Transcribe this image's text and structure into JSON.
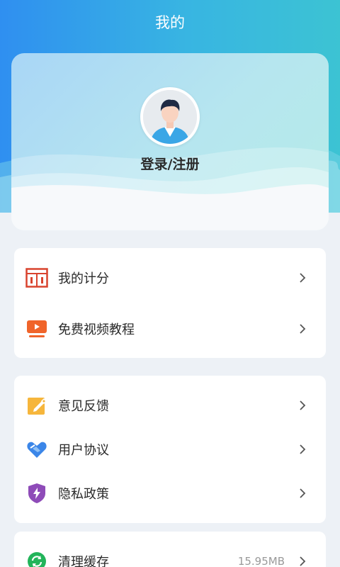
{
  "header": {
    "title": "我的"
  },
  "profile": {
    "login_label": "登录/注册",
    "avatar_icon": "user-avatar-icon"
  },
  "menu_group_1": [
    {
      "label": "我的计分",
      "icon": "score-board-icon"
    },
    {
      "label": "免费视频教程",
      "icon": "video-play-icon"
    }
  ],
  "menu_group_2": [
    {
      "label": "意见反馈",
      "icon": "feedback-pencil-icon"
    },
    {
      "label": "用户协议",
      "icon": "handshake-icon"
    },
    {
      "label": "隐私政策",
      "icon": "privacy-shield-icon"
    }
  ],
  "menu_group_3": [
    {
      "label": "清理缓存",
      "icon": "refresh-cache-icon",
      "value": "15.95MB"
    }
  ],
  "colors": {
    "header_gradient_start": "#2f8ff0",
    "header_gradient_end": "#3cc3d3",
    "page_background": "#edf1f6",
    "score_icon": "#d9432e",
    "video_icon": "#f0642a",
    "feedback_icon": "#f6b63c",
    "agreement_icon": "#3b86e8",
    "privacy_icon": "#8e4bb8",
    "cache_icon": "#22b45a"
  }
}
